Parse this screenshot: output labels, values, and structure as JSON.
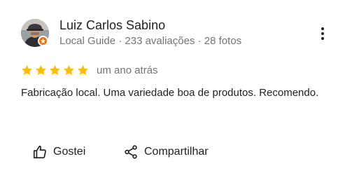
{
  "reviewer": {
    "name": "Luiz Carlos Sabino",
    "meta": "Local Guide · 233 avaliações · 28 fotos"
  },
  "review": {
    "rating": 5,
    "rating_max": 5,
    "time": "um ano atrás",
    "text": "Fabricação local. Uma variedade boa de produtos. Recomendo."
  },
  "actions": {
    "like_label": "Gostei",
    "share_label": "Compartilhar"
  },
  "colors": {
    "star": "#fbbc04",
    "guide_badge": "#e8710a",
    "secondary_text": "#70757a",
    "primary_text": "#202124"
  },
  "icons": {
    "more": "more-vert-icon",
    "like": "thumb-up-icon",
    "share": "share-icon",
    "badge": "local-guide-badge-icon"
  }
}
